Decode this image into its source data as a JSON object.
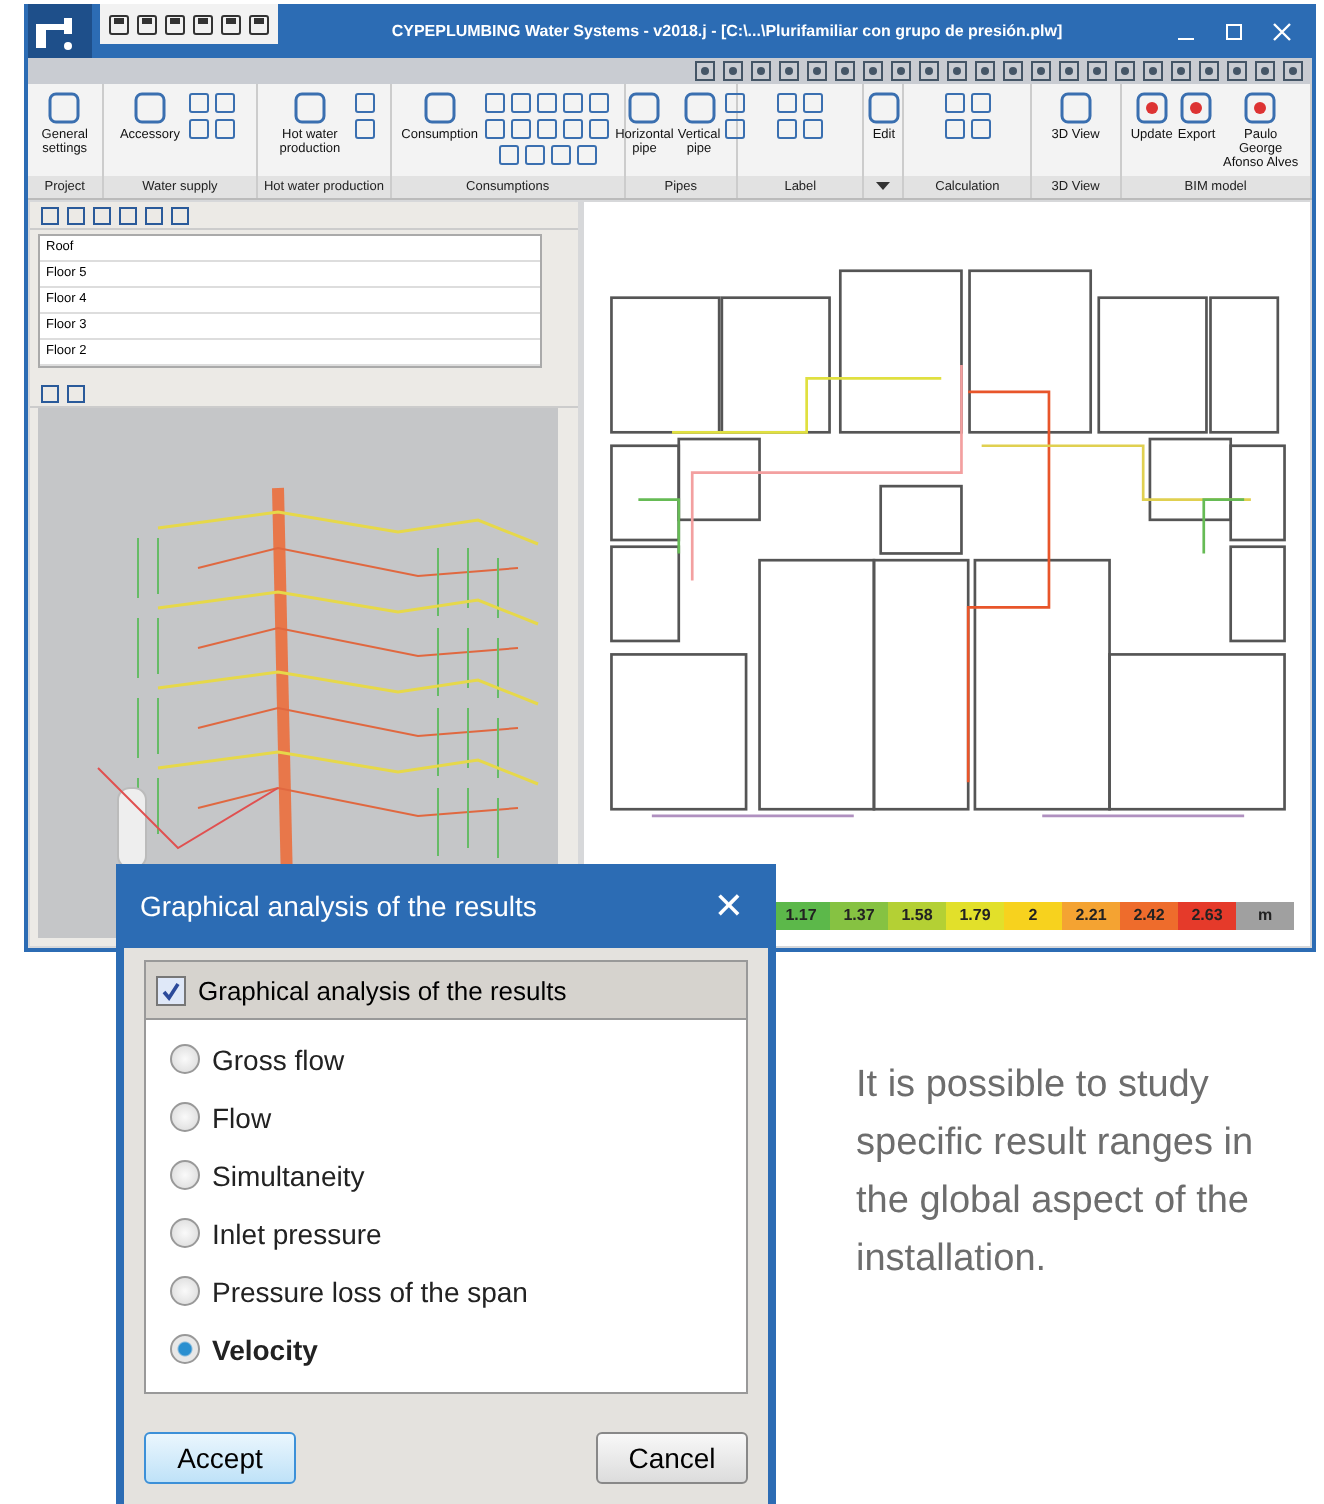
{
  "window": {
    "title": "CYPEPLUMBING Water Systems - v2018.j - [C:\\...\\Plurifamiliar con grupo de presión.plw]"
  },
  "ribbon": {
    "groups": [
      {
        "label": "Project",
        "buttons": [
          {
            "label": "General settings"
          }
        ]
      },
      {
        "label": "Water supply",
        "buttons": [
          {
            "label": "Accessory"
          }
        ]
      },
      {
        "label": "Hot water production",
        "buttons": [
          {
            "label": "Hot water production"
          }
        ]
      },
      {
        "label": "Consumptions",
        "buttons": [
          {
            "label": "Consumption"
          }
        ]
      },
      {
        "label": "Pipes",
        "buttons": [
          {
            "label": "Horizontal pipe"
          },
          {
            "label": "Vertical pipe"
          }
        ]
      },
      {
        "label": "Label"
      },
      {
        "buttons": [
          {
            "label": "Edit"
          }
        ]
      },
      {
        "label": "Calculation"
      },
      {
        "label": "3D View",
        "buttons": [
          {
            "label": "3D View"
          }
        ]
      },
      {
        "label": "BIM model",
        "buttons": [
          {
            "label": "Update"
          },
          {
            "label": "Export"
          },
          {
            "label": "Paulo George Afonso Alves"
          }
        ]
      }
    ]
  },
  "floors": [
    {
      "label": "Roof",
      "selected": false
    },
    {
      "label": "Floor 5",
      "selected": false
    },
    {
      "label": "Floor 4",
      "selected": false
    },
    {
      "label": "Floor 3",
      "selected": false
    },
    {
      "label": "Floor 2",
      "selected": false
    }
  ],
  "legend": [
    {
      "label": "1.17",
      "color": "#5cb84a"
    },
    {
      "label": "1.37",
      "color": "#86c242"
    },
    {
      "label": "1.58",
      "color": "#b4d034"
    },
    {
      "label": "1.79",
      "color": "#e2e02a"
    },
    {
      "label": "2",
      "color": "#f7d21e"
    },
    {
      "label": "2.21",
      "color": "#f4a332"
    },
    {
      "label": "2.42",
      "color": "#ee6c2c"
    },
    {
      "label": "2.63",
      "color": "#e53a2a"
    },
    {
      "label": "m",
      "color": "#a0a0a0"
    }
  ],
  "dialog": {
    "title": "Graphical analysis of the results",
    "close": "✕",
    "group": {
      "label": "Graphical analysis of the results",
      "checked": true
    },
    "options": [
      {
        "label": "Gross flow",
        "selected": false
      },
      {
        "label": "Flow",
        "selected": false
      },
      {
        "label": "Simultaneity",
        "selected": false
      },
      {
        "label": "Inlet pressure",
        "selected": false
      },
      {
        "label": "Pressure loss of the span",
        "selected": false
      },
      {
        "label": "Velocity",
        "selected": true
      }
    ],
    "buttons": [
      {
        "label": "Accept",
        "default": true
      },
      {
        "label": "Cancel",
        "default": false
      }
    ]
  },
  "caption": "It is possible to study specific result ranges in the global aspect of the installation."
}
